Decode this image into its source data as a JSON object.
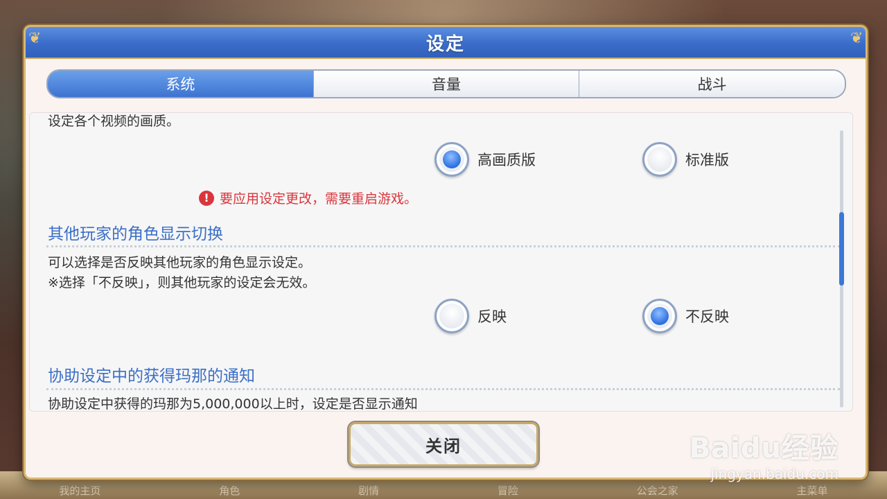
{
  "dialog": {
    "title": "设定"
  },
  "tabs": [
    {
      "label": "系统",
      "active": true
    },
    {
      "label": "音量",
      "active": false
    },
    {
      "label": "战斗",
      "active": false
    }
  ],
  "video_quality": {
    "description": "设定各个视频的画质。",
    "options": [
      {
        "label": "高画质版",
        "selected": true
      },
      {
        "label": "标准版",
        "selected": false
      }
    ],
    "warning": "要应用设定更改，需要重启游戏。"
  },
  "other_player_display": {
    "title": "其他玩家的角色显示切换",
    "description_line1": "可以选择是否反映其他玩家的角色显示设定。",
    "description_line2": "※选择「不反映」，则其他玩家的设定会无效。",
    "options": [
      {
        "label": "反映",
        "selected": false
      },
      {
        "label": "不反映",
        "selected": true
      }
    ]
  },
  "mana_notice": {
    "title": "协助设定中的获得玛那的通知",
    "description": "协助设定中获得的玛那为5,000,000以上时，设定是否显示通知"
  },
  "close_button": {
    "label": "关闭"
  },
  "bottom_nav": [
    "我的主页",
    "角色",
    "剧情",
    "冒险",
    "公会之家",
    "主菜单"
  ],
  "watermark": {
    "main": "Baidu经验",
    "sub": "jingyan.baidu.com"
  },
  "colors": {
    "accent": "#3a6fc6",
    "warning": "#d9363c",
    "title_bar": "#3a6cc9"
  }
}
